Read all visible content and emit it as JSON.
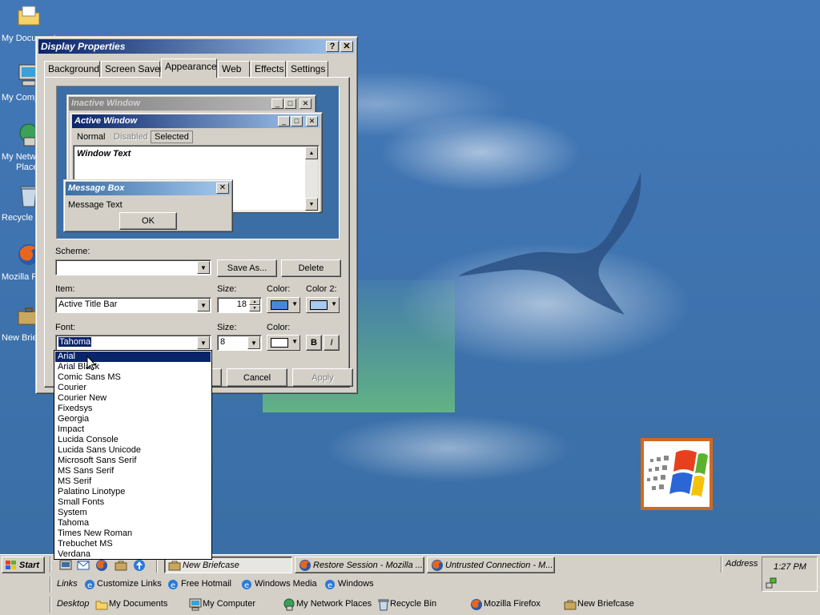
{
  "desktop": {
    "icons": [
      {
        "label": "My Documents"
      },
      {
        "label": "My Comp"
      },
      {
        "label": "My Netw"
      },
      {
        "label": "Place"
      },
      {
        "label": "Recycle"
      },
      {
        "label": "Mozilla Fi"
      },
      {
        "label": "New Brie"
      }
    ]
  },
  "dialog": {
    "title": "Display Properties",
    "help_btn": "?",
    "close_btn": "✕",
    "tabs": [
      {
        "label": "Background"
      },
      {
        "label": "Screen Saver"
      },
      {
        "label": "Appearance"
      },
      {
        "label": "Web"
      },
      {
        "label": "Effects"
      },
      {
        "label": "Settings"
      }
    ],
    "active_tab": "Appearance",
    "preview": {
      "inactive_title": "Inactive Window",
      "active_title": "Active Window",
      "menu": [
        "Normal",
        "Disabled",
        "Selected"
      ],
      "window_text": "Window Text",
      "msgbox_title": "Message Box",
      "msgbox_text": "Message Text",
      "ok": "OK"
    },
    "scheme_label": "Scheme:",
    "scheme_value": "",
    "save_as": "Save As...",
    "delete": "Delete",
    "item_label": "Item:",
    "item_value": "Active Title Bar",
    "size_label": "Size:",
    "item_size": "18",
    "color_label": "Color:",
    "color2_label": "Color 2:",
    "item_color": "#4a86d2",
    "item_color2": "#a6caf0",
    "font_label": "Font:",
    "font_value": "Tahoma",
    "font_size_label": "Size:",
    "font_size": "8",
    "font_color_label": "Color:",
    "font_color": "#ffffff",
    "bold": "B",
    "italic": "I",
    "cancel": "Cancel",
    "apply": "Apply",
    "font_options": [
      "Arial",
      "Arial Black",
      "Comic Sans MS",
      "Courier",
      "Courier New",
      "Fixedsys",
      "Georgia",
      "Impact",
      "Lucida Console",
      "Lucida Sans Unicode",
      "Microsoft Sans Serif",
      "MS Sans Serif",
      "MS Serif",
      "Palatino Linotype",
      "Small Fonts",
      "System",
      "Tahoma",
      "Times New Roman",
      "Trebuchet MS",
      "Verdana"
    ],
    "font_highlighted": "Arial"
  },
  "taskbar": {
    "start": "Start",
    "tasks": [
      {
        "label": "New Briefcase",
        "pressed": true
      },
      {
        "label": "Restore Session - Mozilla ...",
        "pressed": false
      },
      {
        "label": "Untrusted Connection - M...",
        "pressed": false
      }
    ],
    "address_label": "Address",
    "clock": "1:27 PM",
    "links_label": "Links",
    "links": [
      "Customize Links",
      "Free Hotmail",
      "Windows Media",
      "Windows"
    ],
    "desktop_label": "Desktop",
    "desktop_items": [
      "My Documents",
      "My Computer",
      "My Network Places",
      "Recycle Bin",
      "Mozilla Firefox",
      "New Briefcase"
    ]
  }
}
